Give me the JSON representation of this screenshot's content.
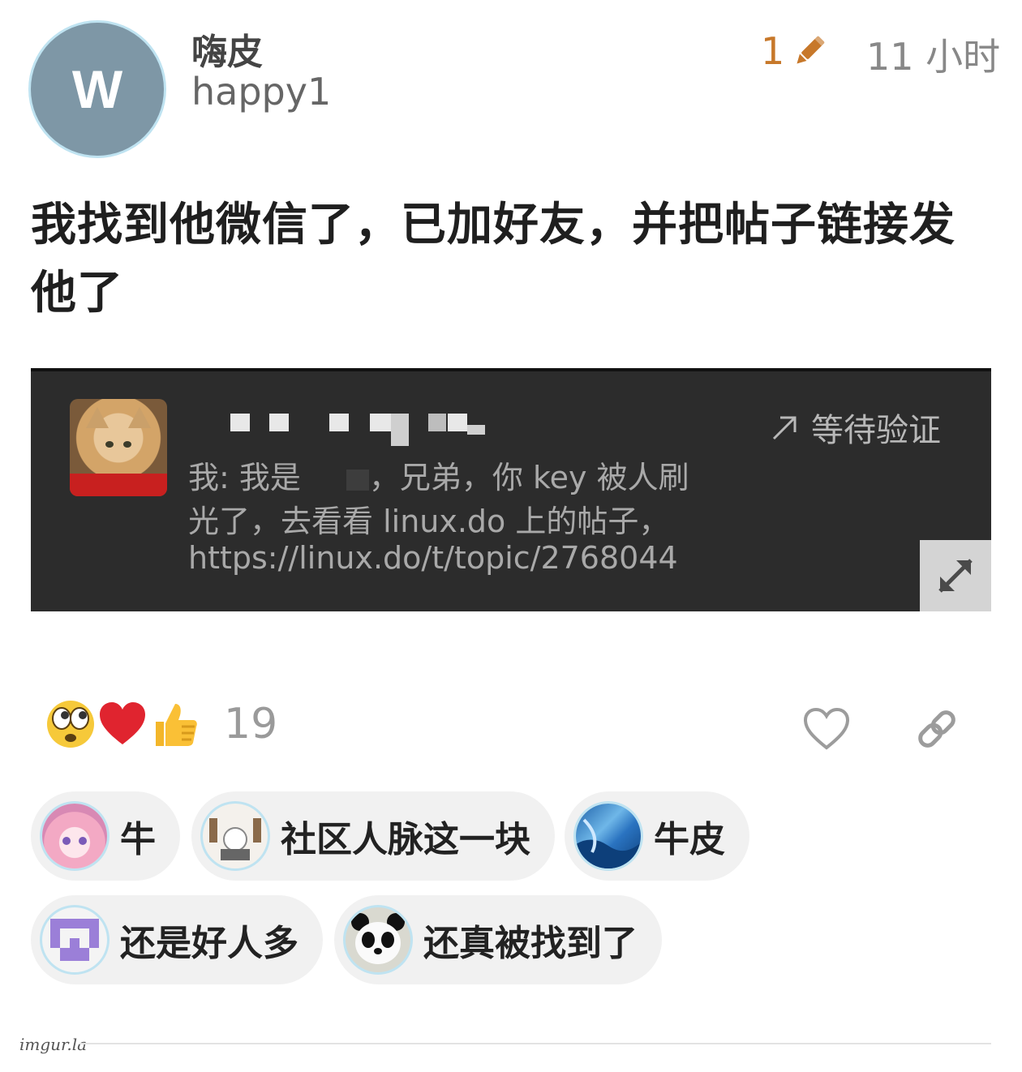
{
  "post": {
    "avatar_letter": "W",
    "display_name": "嗨皮",
    "username": "happy1",
    "edit_count": "1",
    "time": "11 小时",
    "body_line1": "我找到他微信了，已加好友，并把帖子链接发",
    "body_line2": "他了"
  },
  "embed": {
    "status": "等待验证",
    "line1": "我: 我是",
    "line1_tail": "，兄弟，你 key 被人刷",
    "line2": "光了，去看看 linux.do 上的帖子，",
    "line3": "https://linux.do/t/topic/2768044"
  },
  "reactions": {
    "count": "19",
    "icons": [
      "eyes-emoji-icon",
      "red-heart-icon",
      "thumbs-up-icon"
    ]
  },
  "replies": [
    {
      "text": "牛",
      "avatar": "anime-girl-avatar"
    },
    {
      "text": "社区人脉这一块",
      "avatar": "cat-at-laptop-avatar"
    },
    {
      "text": "牛皮",
      "avatar": "blue-wave-avatar"
    },
    {
      "text": "还是好人多",
      "avatar": "purple-pixel-avatar"
    },
    {
      "text": "还真被找到了",
      "avatar": "panda-avatar"
    }
  ],
  "watermark": "imgur.la",
  "colors": {
    "accent_edit": "#c7782a",
    "heart_red": "#e0242f",
    "chip_bg": "#f1f1f1"
  }
}
